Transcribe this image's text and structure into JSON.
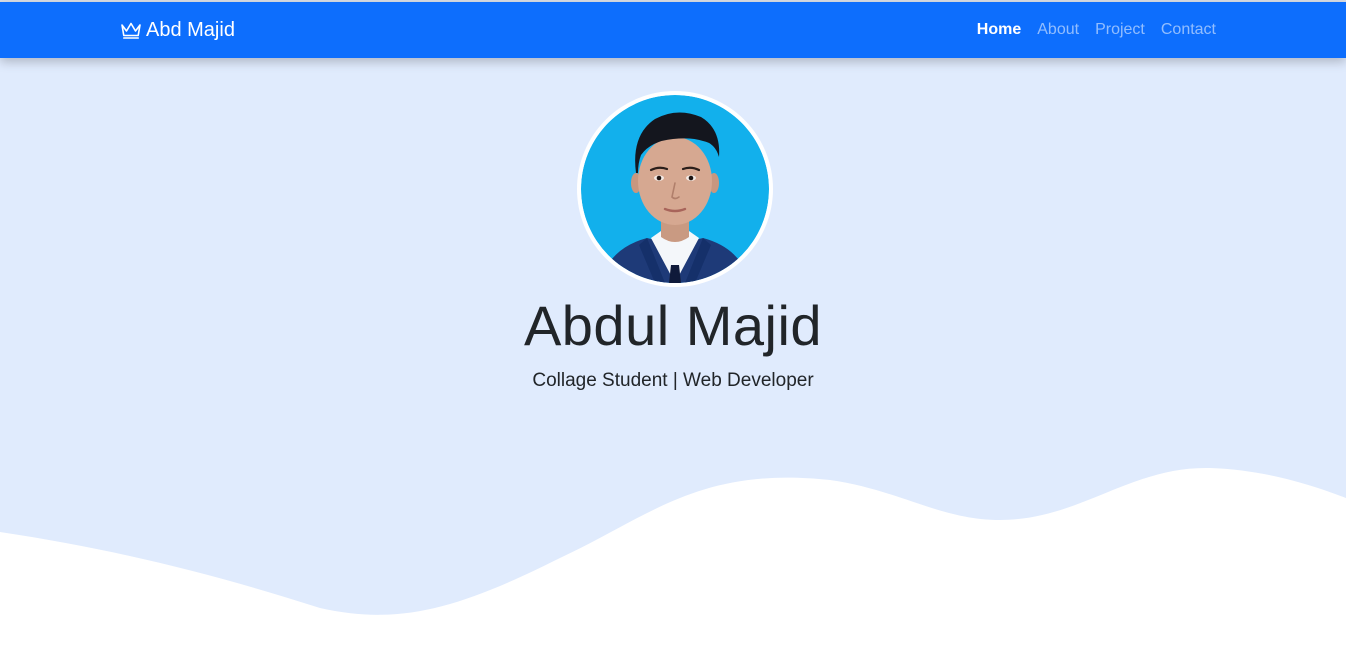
{
  "navbar": {
    "brand_icon": "crown-icon",
    "brand_text": "Abd Majid",
    "links": [
      {
        "label": "Home",
        "active": true
      },
      {
        "label": "About",
        "active": false
      },
      {
        "label": "Project",
        "active": false
      },
      {
        "label": "Contact",
        "active": false
      }
    ]
  },
  "hero": {
    "name": "Abdul Majid",
    "tagline": "Collage Student | Web Developer"
  },
  "colors": {
    "navbar_bg": "#0d6efd",
    "hero_bg": "#e0ebfd",
    "wave": "#ffffff",
    "photo_bg": "#12b0ec"
  }
}
